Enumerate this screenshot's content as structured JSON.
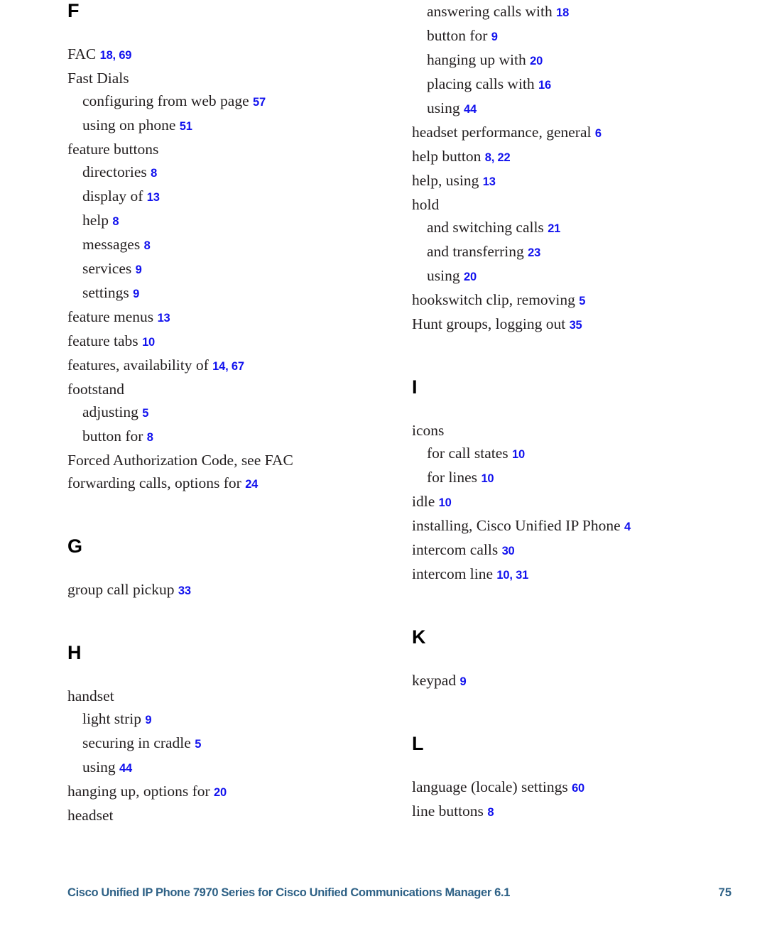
{
  "footer": {
    "title": "Cisco Unified IP Phone 7970 Series for Cisco Unified Communications Manager 6.1",
    "page_number": "75"
  },
  "colors": {
    "page_number_link": "#1111ee",
    "footer_text": "#2e6186",
    "body_text": "#231f20",
    "heading": "#000000"
  },
  "columns": [
    {
      "name": "left-column",
      "blocks": [
        {
          "letter": "F",
          "first": true,
          "entries": [
            {
              "level": 1,
              "text": "FAC",
              "pages": "18, 69"
            },
            {
              "level": 1,
              "text": "Fast Dials",
              "pages": ""
            },
            {
              "level": 2,
              "text": "configuring from web page",
              "pages": "57"
            },
            {
              "level": 2,
              "text": "using on phone",
              "pages": "51"
            },
            {
              "level": 1,
              "text": "feature buttons",
              "pages": ""
            },
            {
              "level": 2,
              "text": "directories",
              "pages": "8"
            },
            {
              "level": 2,
              "text": "display of",
              "pages": "13"
            },
            {
              "level": 2,
              "text": "help",
              "pages": "8"
            },
            {
              "level": 2,
              "text": "messages",
              "pages": "8"
            },
            {
              "level": 2,
              "text": "services",
              "pages": "9"
            },
            {
              "level": 2,
              "text": "settings",
              "pages": "9"
            },
            {
              "level": 1,
              "text": "feature menus",
              "pages": "13"
            },
            {
              "level": 1,
              "text": "feature tabs",
              "pages": "10"
            },
            {
              "level": 1,
              "text": "features, availability of",
              "pages": "14, 67"
            },
            {
              "level": 1,
              "text": "footstand",
              "pages": ""
            },
            {
              "level": 2,
              "text": "adjusting",
              "pages": "5"
            },
            {
              "level": 2,
              "text": "button for",
              "pages": "8"
            },
            {
              "level": 1,
              "text": "Forced Authorization Code, see FAC",
              "pages": ""
            },
            {
              "level": 1,
              "text": "forwarding calls, options for",
              "pages": "24"
            }
          ]
        },
        {
          "letter": "G",
          "first": false,
          "entries": [
            {
              "level": 1,
              "text": "group call pickup",
              "pages": "33"
            }
          ]
        },
        {
          "letter": "H",
          "first": false,
          "entries": [
            {
              "level": 1,
              "text": "handset",
              "pages": ""
            },
            {
              "level": 2,
              "text": "light strip",
              "pages": "9"
            },
            {
              "level": 2,
              "text": "securing in cradle",
              "pages": "5"
            },
            {
              "level": 2,
              "text": "using",
              "pages": "44"
            },
            {
              "level": 1,
              "text": "hanging up, options for",
              "pages": "20"
            },
            {
              "level": 1,
              "text": "headset",
              "pages": ""
            }
          ]
        }
      ]
    },
    {
      "name": "right-column",
      "blocks": [
        {
          "letter": "",
          "first": true,
          "entries": [
            {
              "level": 2,
              "text": "answering calls with",
              "pages": "18"
            },
            {
              "level": 2,
              "text": "button for",
              "pages": "9"
            },
            {
              "level": 2,
              "text": "hanging up with",
              "pages": "20"
            },
            {
              "level": 2,
              "text": "placing calls with",
              "pages": "16"
            },
            {
              "level": 2,
              "text": "using",
              "pages": "44"
            },
            {
              "level": 1,
              "text": "headset performance, general",
              "pages": "6"
            },
            {
              "level": 1,
              "text": "help button",
              "pages": "8, 22"
            },
            {
              "level": 1,
              "text": "help, using",
              "pages": "13"
            },
            {
              "level": 1,
              "text": "hold",
              "pages": ""
            },
            {
              "level": 2,
              "text": "and switching calls",
              "pages": "21"
            },
            {
              "level": 2,
              "text": "and transferring",
              "pages": "23"
            },
            {
              "level": 2,
              "text": "using",
              "pages": "20"
            },
            {
              "level": 1,
              "text": "hookswitch clip, removing",
              "pages": "5"
            },
            {
              "level": 1,
              "text": "Hunt groups, logging out",
              "pages": "35"
            }
          ]
        },
        {
          "letter": "I",
          "first": false,
          "entries": [
            {
              "level": 1,
              "text": "icons",
              "pages": ""
            },
            {
              "level": 2,
              "text": "for call states",
              "pages": "10"
            },
            {
              "level": 2,
              "text": "for lines",
              "pages": "10"
            },
            {
              "level": 1,
              "text": "idle",
              "pages": "10"
            },
            {
              "level": 1,
              "text": "installing, Cisco Unified IP Phone",
              "pages": "4"
            },
            {
              "level": 1,
              "text": "intercom calls",
              "pages": "30"
            },
            {
              "level": 1,
              "text": "intercom line",
              "pages": "10, 31"
            }
          ]
        },
        {
          "letter": "K",
          "first": false,
          "entries": [
            {
              "level": 1,
              "text": "keypad",
              "pages": "9"
            }
          ]
        },
        {
          "letter": "L",
          "first": false,
          "entries": [
            {
              "level": 1,
              "text": "language (locale) settings",
              "pages": "60"
            },
            {
              "level": 1,
              "text": "line buttons",
              "pages": "8"
            }
          ]
        }
      ]
    }
  ]
}
